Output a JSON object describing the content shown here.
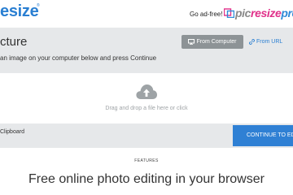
{
  "header": {
    "logo_text": "esize",
    "logo_mark": "®",
    "adfree_label": "Go ad-free!",
    "promo": {
      "pic": "pic",
      "resize": "resize",
      "pro": "pro"
    }
  },
  "upload": {
    "title": "cture",
    "subtitle": "an image on your computer below and press Continue",
    "from_computer_label": "From Computer",
    "from_url_label": "From URL",
    "dropzone_text": "Drag and drop a file here or click",
    "clipboard_label": "Clipboard",
    "continue_label": "CONTINUE TO EDI"
  },
  "features": {
    "label": "FEATURES",
    "heading": "Free online photo editing in your browser"
  },
  "colors": {
    "accent": "#2a7fd2",
    "panel_bg": "#e6e8ea",
    "button_grey": "#8d9396",
    "promo_pink": "#e0318a"
  },
  "icons": [
    "monitor-icon",
    "link-icon",
    "cloud-upload-icon",
    "picresize-logo-icon"
  ]
}
